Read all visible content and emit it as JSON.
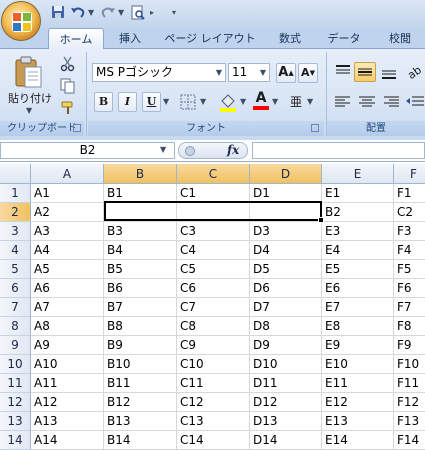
{
  "tabs": [
    {
      "label": "ホーム",
      "active": true
    },
    {
      "label": "挿入"
    },
    {
      "label": "ページ レイアウト"
    },
    {
      "label": "数式"
    },
    {
      "label": "データ"
    },
    {
      "label": "校閲"
    }
  ],
  "quick_access": {
    "icons": [
      "save-icon",
      "undo-icon",
      "redo-icon",
      "print-preview-icon",
      "customize-icon"
    ]
  },
  "ribbon": {
    "clipboard": {
      "paste_label": "貼り付け",
      "group_label": "クリップボード"
    },
    "font": {
      "font_name": "MS Pゴシック",
      "font_size": "11",
      "grow_label": "A",
      "shrink_label": "A",
      "bold": "B",
      "italic": "I",
      "underline": "U",
      "font_color_label": "A",
      "phonetic_label": "亜",
      "group_label": "フォント",
      "highlight_color": "#ffff00",
      "font_color": "#ff0000"
    },
    "alignment": {
      "group_label": "配置"
    }
  },
  "formula_bar": {
    "name_box": "B2",
    "fx_label": "fx",
    "formula": ""
  },
  "grid": {
    "columns": [
      "A",
      "B",
      "C",
      "D",
      "E",
      "F"
    ],
    "selected_columns": [
      "B",
      "C",
      "D"
    ],
    "selected_row": "2",
    "rows": [
      {
        "num": "1",
        "cells": [
          "A1",
          "B1",
          "C1",
          "D1",
          "E1",
          "F1"
        ]
      },
      {
        "num": "2",
        "cells": [
          "A2",
          "",
          "",
          "",
          "B2",
          "C2"
        ]
      },
      {
        "num": "3",
        "cells": [
          "A3",
          "B3",
          "C3",
          "D3",
          "E3",
          "F3"
        ]
      },
      {
        "num": "4",
        "cells": [
          "A4",
          "B4",
          "C4",
          "D4",
          "E4",
          "F4"
        ]
      },
      {
        "num": "5",
        "cells": [
          "A5",
          "B5",
          "C5",
          "D5",
          "E5",
          "F5"
        ]
      },
      {
        "num": "6",
        "cells": [
          "A6",
          "B6",
          "C6",
          "D6",
          "E6",
          "F6"
        ]
      },
      {
        "num": "7",
        "cells": [
          "A7",
          "B7",
          "C7",
          "D7",
          "E7",
          "F7"
        ]
      },
      {
        "num": "8",
        "cells": [
          "A8",
          "B8",
          "C8",
          "D8",
          "E8",
          "F8"
        ]
      },
      {
        "num": "9",
        "cells": [
          "A9",
          "B9",
          "C9",
          "D9",
          "E9",
          "F9"
        ]
      },
      {
        "num": "10",
        "cells": [
          "A10",
          "B10",
          "C10",
          "D10",
          "E10",
          "F10"
        ]
      },
      {
        "num": "11",
        "cells": [
          "A11",
          "B11",
          "C11",
          "D11",
          "E11",
          "F11"
        ]
      },
      {
        "num": "12",
        "cells": [
          "A12",
          "B12",
          "C12",
          "D12",
          "E12",
          "F12"
        ]
      },
      {
        "num": "13",
        "cells": [
          "A13",
          "B13",
          "C13",
          "D13",
          "E13",
          "F13"
        ]
      },
      {
        "num": "14",
        "cells": [
          "A14",
          "B14",
          "C14",
          "D14",
          "E14",
          "F14"
        ]
      }
    ]
  }
}
